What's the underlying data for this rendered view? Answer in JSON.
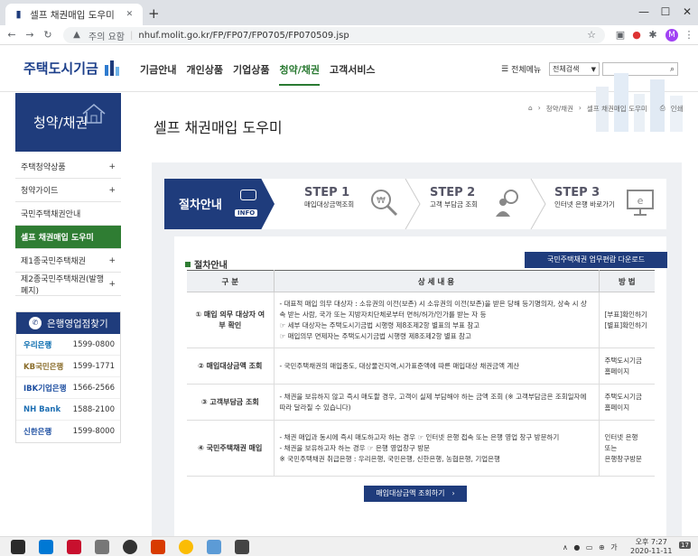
{
  "browser": {
    "tab_title": "셀프 채권매입 도우미 < 청",
    "tab_close": "✕",
    "new_tab": "+",
    "security": "주의 요함",
    "url": "nhuf.molit.go.kr/FP/FP07/FP0705/FP070509.jsp",
    "profile_initial": "M"
  },
  "header": {
    "logo_text": "주택도시기금",
    "nav": [
      "기금안내",
      "개인상품",
      "기업상품",
      "청약/채권",
      "고객서비스"
    ],
    "all_menu": "전체메뉴",
    "search_select": "전체검색"
  },
  "sidebar": {
    "title": "청약/채권",
    "items": [
      {
        "label": "주택청약상품",
        "toggle": "+"
      },
      {
        "label": "청약가이드",
        "toggle": "+"
      },
      {
        "label": "국민주택채권안내",
        "toggle": ""
      },
      {
        "label": "셀프 채권매입 도우미",
        "toggle": ""
      },
      {
        "label": "제1종국민주택채권",
        "toggle": "+"
      },
      {
        "label": "제2종국민주택채권(발행폐지)",
        "toggle": "+"
      }
    ],
    "bank_title": "은행영업점찾기",
    "banks": [
      {
        "name": "우리은행",
        "phone": "1599-0800"
      },
      {
        "name": "KB국민은행",
        "phone": "1599-1771"
      },
      {
        "name": "IBK기업은행",
        "phone": "1566-2566"
      },
      {
        "name": "NH Bank",
        "phone": "1588-2100"
      },
      {
        "name": "신한은행",
        "phone": "1599-8000"
      }
    ]
  },
  "breadcrumb": [
    "청약/채권",
    "셀프 채권매입 도우미",
    "인쇄"
  ],
  "page_title": "셀프 채권매입 도우미",
  "steps": {
    "info_label": "절차안내",
    "info_tag": "INFO",
    "step1": {
      "num": "STEP 1",
      "desc": "매입대상금액조회"
    },
    "step2": {
      "num": "STEP 2",
      "desc": "고객 부담금 조회"
    },
    "step3": {
      "num": "STEP 3",
      "desc": "인터넷 은행 바로가기"
    }
  },
  "section": {
    "title": "절차안내",
    "download_button": "국민주택채권 업무편람 다운로드"
  },
  "table": {
    "headers": [
      "구 분",
      "상 세 내 용",
      "방 법"
    ],
    "rows": [
      {
        "label": "① 매입 의무 대상자 여부 확인",
        "detail": [
          "- 대표적 매입 의무 대상자 : 소유권의 이전(보존) 시 소유권의 이전(보존)을 받은 당해 등기명의자, 상속 시 상속 받는 사람, 국가 또는 지방자치단체로부터 면허/허가/인가를 받는 자 등",
          "☞ 세부 대상자는 주택도시기금법 시행령 제8조제2항 별표의 부표 참고",
          "☞ 매입의무 면제자는 주택도시기금법 시행령 제8조제2항 별표 참고"
        ],
        "method": [
          "[부표]확인하기",
          "[별표]확인하기"
        ]
      },
      {
        "label": "② 매입대상금액 조회",
        "detail": [
          "- 국민주택채권의 매입종도, 대상물건지역,시가표준액에 따른 매입대상 채권금액 계산"
        ],
        "method": [
          "주택도시기금",
          "홈페이지"
        ]
      },
      {
        "label": "③ 고객부담금 조회",
        "detail": [
          "- 채권을 보유하지 않고 즉시 매도할 경우, 고객이 실제 부담해야 하는 금액 조회 (※ 고객부담금은 조회일자에 따라 달라질 수 있습니다)"
        ],
        "method": [
          "주택도시기금",
          "홈페이지"
        ]
      },
      {
        "label": "④ 국민주택채권 매입",
        "detail": [
          "- 채권 매입과 동시에 즉시 매도하고자 하는 경우 ☞ 인터넷 은행 접속 또는 은행 영업 창구 방문하기",
          "- 채권을 보유하고자 하는 경우 ☞ 은행 영업창구 방문",
          "※ 국민주택채권 취급은행 : 우리은행, 국민은행, 신한은행, 농협은행, 기업은행"
        ],
        "method": [
          "인터넷 은행",
          "또는",
          "은행창구방문"
        ]
      }
    ]
  },
  "bottom_button": "매입대상금액 조회하기",
  "taskbar": {
    "time": "오후 7:27",
    "date": "2020-11-11",
    "notify": "17"
  }
}
